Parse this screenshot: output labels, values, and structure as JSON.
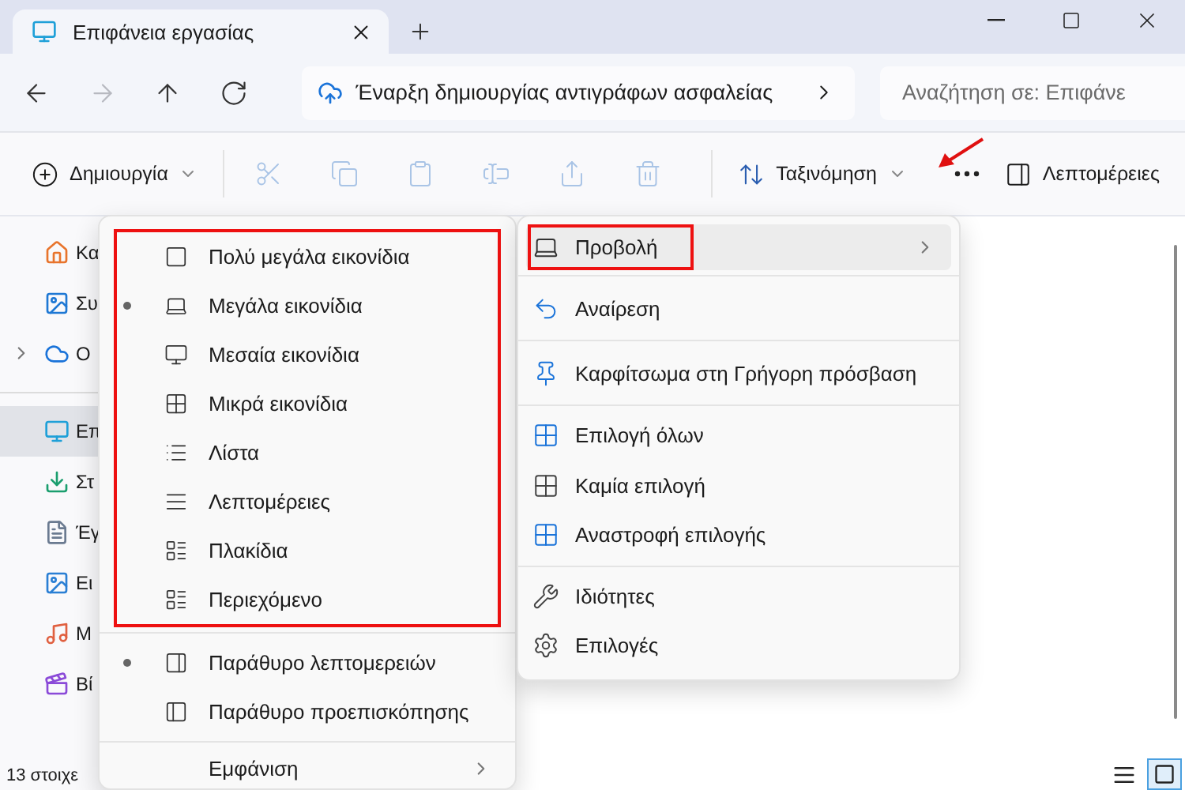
{
  "tab": {
    "title": "Επιφάνεια εργασίας"
  },
  "navigation": [
    {
      "kind": "back",
      "disabled": false
    },
    {
      "kind": "forward",
      "disabled": true
    },
    {
      "kind": "up",
      "disabled": false
    },
    {
      "kind": "refresh",
      "disabled": false
    }
  ],
  "address": {
    "text": "Έναρξη δημιουργίας αντιγράφων ασφαλείας"
  },
  "search": {
    "placeholder": "Αναζήτηση σε: Επιφάνε"
  },
  "toolbar": {
    "new": {
      "label": "Δημιουργία"
    },
    "actions": [
      {
        "kind": "cut",
        "disabled": true
      },
      {
        "kind": "copy",
        "disabled": true
      },
      {
        "kind": "paste",
        "disabled": true
      },
      {
        "kind": "rename",
        "disabled": true
      },
      {
        "kind": "share",
        "disabled": true
      },
      {
        "kind": "delete",
        "disabled": true
      }
    ],
    "sort": {
      "label": "Ταξινόμηση"
    },
    "more": {
      "annotated": true
    },
    "details": {
      "label": "Λεπτομέρειες"
    }
  },
  "sidebar": {
    "groups": [
      [
        {
          "label": "Κα",
          "kind": "home",
          "selected": false,
          "expandable": false
        },
        {
          "label": "Συ",
          "kind": "gallery",
          "selected": false,
          "expandable": false
        },
        {
          "label": "O",
          "kind": "cloud",
          "selected": false,
          "expandable": true
        }
      ],
      [
        {
          "label": "Επ",
          "kind": "desktop",
          "selected": true,
          "expandable": false
        },
        {
          "label": "Στ",
          "kind": "downloads",
          "selected": false,
          "expandable": false
        },
        {
          "label": "Έγ",
          "kind": "documents",
          "selected": false,
          "expandable": false
        },
        {
          "label": "Ει",
          "kind": "pictures",
          "selected": false,
          "expandable": false
        },
        {
          "label": "Μ",
          "kind": "music",
          "selected": false,
          "expandable": false
        },
        {
          "label": "Βί",
          "kind": "videos",
          "selected": false,
          "expandable": false
        }
      ]
    ],
    "status": "13 στοιχε"
  },
  "view_toggle": [
    {
      "kind": "details",
      "selected": false
    },
    {
      "kind": "large",
      "selected": true
    }
  ],
  "view_menu": {
    "layouts": {
      "annotated": true,
      "items": [
        {
          "label": "Πολύ μεγάλα εικονίδια",
          "kind": "xl",
          "selected": false
        },
        {
          "label": "Μεγάλα εικονίδια",
          "kind": "large",
          "selected": true
        },
        {
          "label": "Μεσαία εικονίδια",
          "kind": "medium",
          "selected": false
        },
        {
          "label": "Μικρά εικονίδια",
          "kind": "small",
          "selected": false
        },
        {
          "label": "Λίστα",
          "kind": "list",
          "selected": false
        },
        {
          "label": "Λεπτομέρειες",
          "kind": "details",
          "selected": false
        },
        {
          "label": "Πλακίδια",
          "kind": "tiles",
          "selected": false
        },
        {
          "label": "Περιεχόμενο",
          "kind": "content",
          "selected": false
        }
      ]
    },
    "panes": [
      {
        "label": "Παράθυρο λεπτομερειών",
        "kind": "details-pane",
        "selected": true
      },
      {
        "label": "Παράθυρο προεπισκόπησης",
        "kind": "preview-pane",
        "selected": false
      }
    ],
    "footer": {
      "label": "Εμφάνιση",
      "has_submenu": true
    }
  },
  "more_menu": {
    "groups": [
      [
        {
          "label": "Προβολή",
          "kind": "view",
          "has_submenu": true,
          "highlighted": true,
          "annotated": true
        }
      ],
      [
        {
          "label": "Αναίρεση",
          "kind": "undo",
          "has_submenu": false,
          "highlighted": false,
          "annotated": false
        }
      ],
      [
        {
          "label": "Καρφίτσωμα στη Γρήγορη πρόσβαση",
          "kind": "pin",
          "has_submenu": false,
          "highlighted": false,
          "annotated": false
        }
      ],
      [
        {
          "label": "Επιλογή όλων",
          "kind": "select-all",
          "has_submenu": false,
          "highlighted": false,
          "annotated": false
        },
        {
          "label": "Καμία επιλογή",
          "kind": "select-none",
          "has_submenu": false,
          "highlighted": false,
          "annotated": false
        },
        {
          "label": "Αναστροφή επιλογής",
          "kind": "invert",
          "has_submenu": false,
          "highlighted": false,
          "annotated": false
        }
      ],
      [
        {
          "label": "Ιδιότητες",
          "kind": "properties",
          "has_submenu": false,
          "highlighted": false,
          "annotated": false
        },
        {
          "label": "Επιλογές",
          "kind": "options",
          "has_submenu": false,
          "highlighted": false,
          "annotated": false
        }
      ]
    ]
  }
}
